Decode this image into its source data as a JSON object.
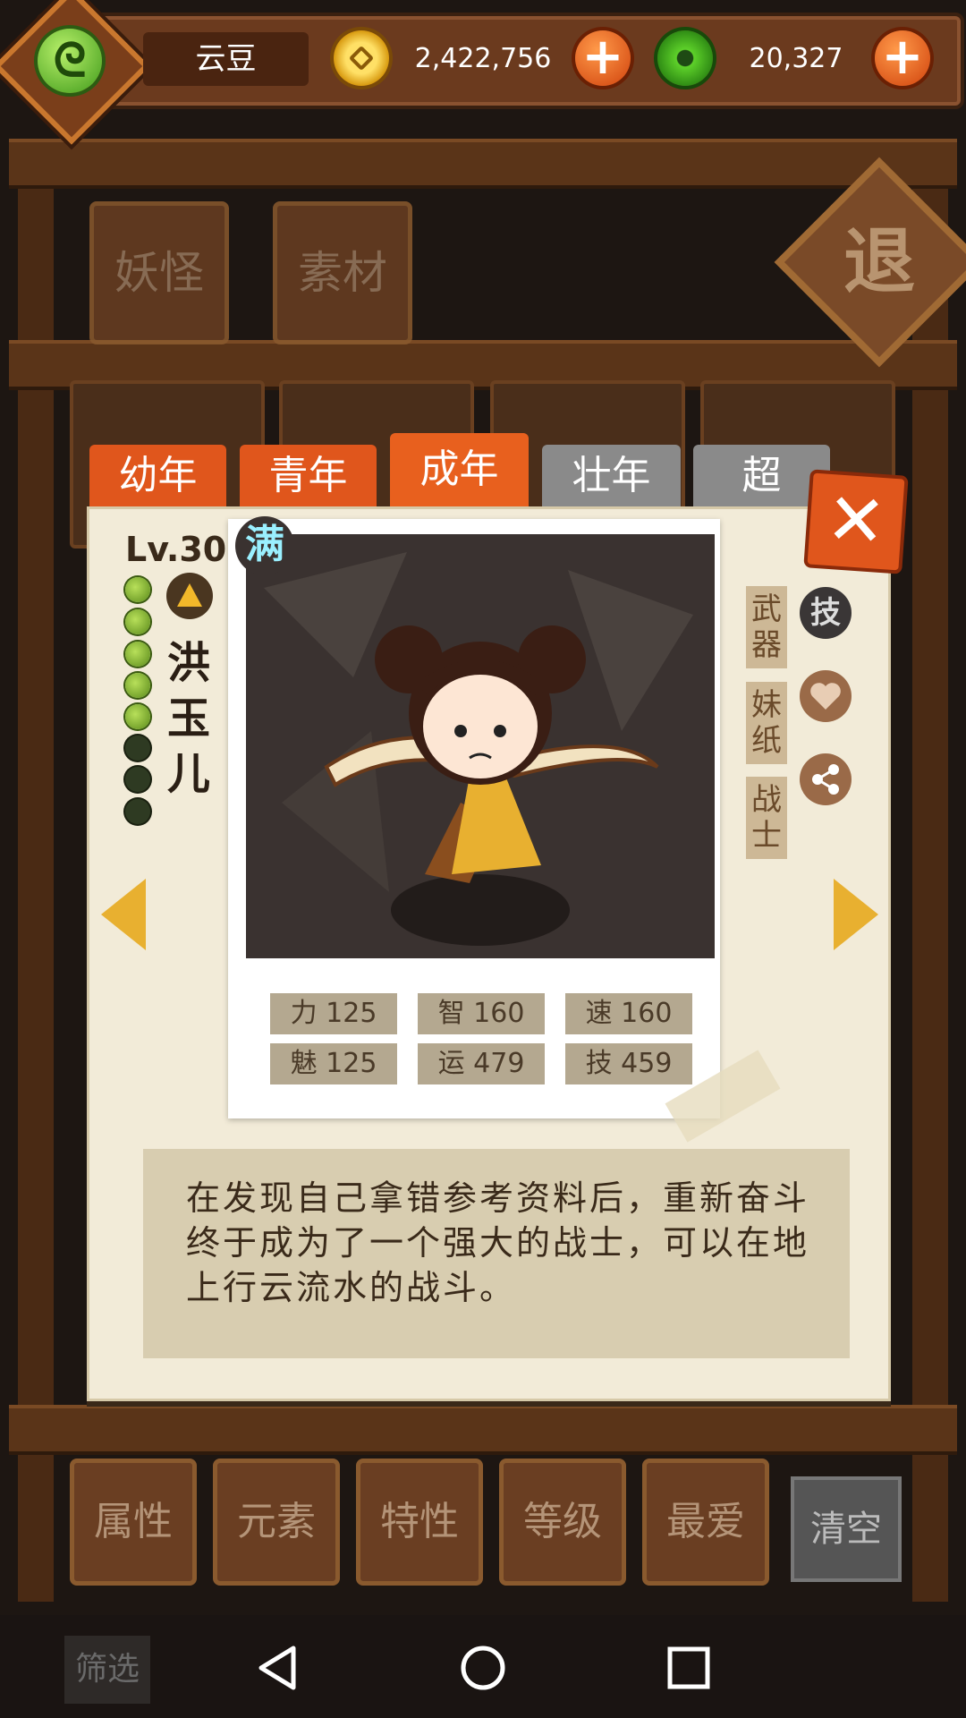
{
  "header": {
    "currency_name": "云豆",
    "gold": "2,422,756",
    "jade": "20,327",
    "plus": "+"
  },
  "categories": [
    "妖怪",
    "素材"
  ],
  "exit_label": "退",
  "age_tabs": [
    "幼年",
    "青年",
    "成年",
    "壮年",
    "超"
  ],
  "close_label": "✕",
  "character": {
    "level": "Lv.30",
    "full_badge": "满",
    "name": "洪玉儿",
    "pips_filled": 5,
    "pips_total": 8,
    "tags": [
      "武器",
      "妹纸",
      "战士"
    ],
    "skill_icon_label": "技"
  },
  "stats": [
    {
      "label": "力",
      "value": "125"
    },
    {
      "label": "智",
      "value": "160"
    },
    {
      "label": "速",
      "value": "160"
    },
    {
      "label": "魅",
      "value": "125"
    },
    {
      "label": "运",
      "value": "479"
    },
    {
      "label": "技",
      "value": "459"
    }
  ],
  "description": "在发现自己拿错参考资料后，重新奋斗终于成为了一个强大的战士，可以在地上行云流水的战斗。",
  "sort_buttons": [
    "属性",
    "元素",
    "特性",
    "等级",
    "最爱"
  ],
  "clear_label": "清空",
  "filter_label": "筛选",
  "colors": {
    "accent": "#e0561c",
    "gold": "#e8b030",
    "panel": "#f2ebd8"
  }
}
